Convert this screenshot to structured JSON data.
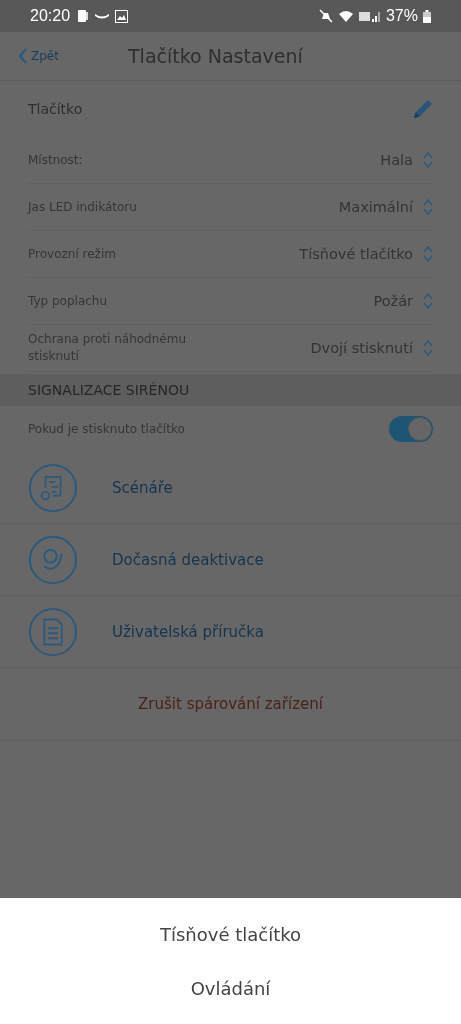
{
  "status_bar": {
    "time": "20:20",
    "battery": "37%"
  },
  "header": {
    "back": "Zpět",
    "title": "Tlačítko Nastavení"
  },
  "device": {
    "name": "Tlačítko"
  },
  "settings": [
    {
      "label": "Místnost:",
      "value": "Hala"
    },
    {
      "label": "Jas LED indikátoru",
      "value": "Maximální"
    },
    {
      "label": "Provozní režim",
      "value": "Tísňové tlačítko"
    },
    {
      "label": "Typ poplachu",
      "value": "Požár"
    },
    {
      "label": "Ochrana proti náhodnému stisknutí",
      "value": "Dvojí stisknutí"
    }
  ],
  "section": {
    "title": "SIGNALIZACE SIRÉNOU",
    "toggle": {
      "label": "Pokud je stisknuto tlačítko",
      "on": true
    }
  },
  "links": [
    {
      "kind": "scenarios",
      "label": "Scénáře"
    },
    {
      "kind": "deactivate",
      "label": "Dočasná deaktivace"
    },
    {
      "kind": "manual",
      "label": "Uživatelská příručka"
    }
  ],
  "unpair": "Zrušit spárování zařízení",
  "sheet": {
    "options": [
      "Tísňové tlačítko",
      "Ovládání"
    ]
  }
}
